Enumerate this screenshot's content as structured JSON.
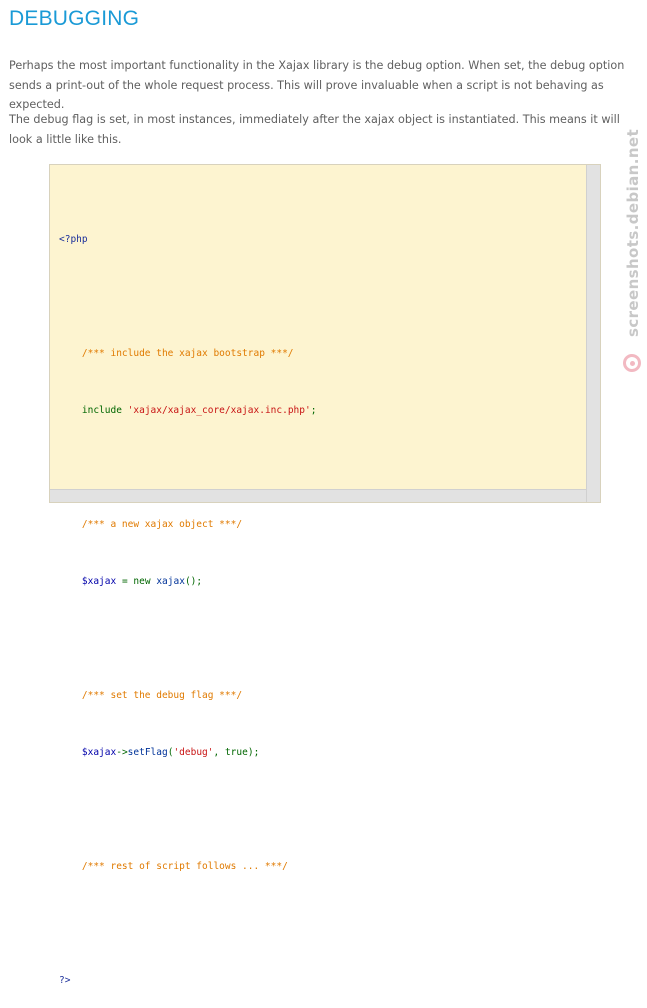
{
  "article": {
    "title": "DEBUGGING",
    "paragraphs": [
      "Perhaps the most important functionality in the Xajax library is the debug option. When set, the debug option sends a print-out of the whole request process. This will prove invaluable when a script is not behaving as expected.",
      "The debug flag is set, in most instances, immediately after the xajax object is instantiated. This means it will look a little like this."
    ]
  },
  "code_block": {
    "open_tag": "<?php",
    "comment_include": "/*** include the xajax bootstrap ***/",
    "include_keyword": "include",
    "include_path": "'xajax/xajax_core/xajax.inc.php'",
    "comment_new": "/*** a new xajax object ***/",
    "var_xajax": "$xajax",
    "new_keyword": "new",
    "class_name": "xajax",
    "comment_debug": "/*** set the debug flag ***/",
    "method_name": "setFlag",
    "flag_arg": "'debug'",
    "true_keyword": "true",
    "comment_rest": "/*** rest of script follows ... ***/",
    "close_tag": "?>"
  },
  "watermark": {
    "text": "screenshots.debian.net"
  },
  "colors": {
    "title": "#1a9ad6",
    "code_background": "#fdf4d0",
    "comment": "#e07a00",
    "string": "#c81414"
  }
}
